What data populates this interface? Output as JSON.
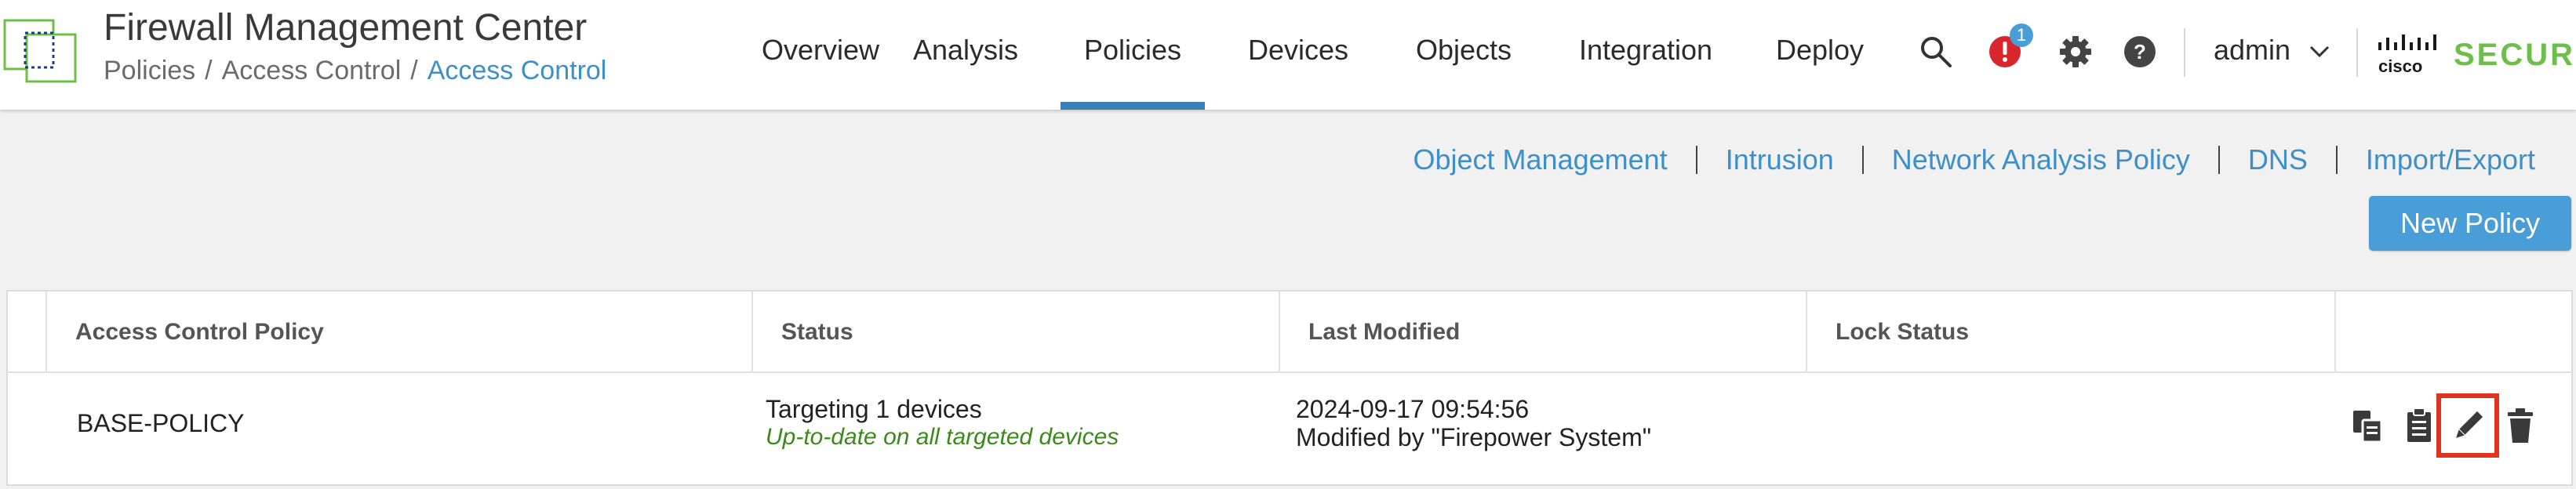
{
  "app": {
    "title": "Firewall Management Center",
    "breadcrumb": [
      "Policies",
      "Access Control",
      "Access Control"
    ],
    "breadcrumb_separator": "/"
  },
  "nav": {
    "items": [
      {
        "label": "Overview",
        "active": false
      },
      {
        "label": "Analysis",
        "active": false
      },
      {
        "label": "Policies",
        "active": true
      },
      {
        "label": "Devices",
        "active": false
      },
      {
        "label": "Objects",
        "active": false
      },
      {
        "label": "Integration",
        "active": false
      },
      {
        "label": "Deploy",
        "active": false
      }
    ],
    "alert_count": "1",
    "user": "admin",
    "brand_word": "SECURE",
    "brand_logo_text": "cisco"
  },
  "subnav": {
    "links": [
      "Object Management",
      "Intrusion",
      "Network Analysis Policy",
      "DNS",
      "Import/Export"
    ]
  },
  "actions": {
    "new_policy": "New Policy"
  },
  "table": {
    "columns": [
      "Access Control Policy",
      "Status",
      "Last Modified",
      "Lock Status"
    ],
    "rows": [
      {
        "name": "BASE-POLICY",
        "status": "Targeting 1 devices",
        "status_detail": "Up-to-date on all targeted devices",
        "modified_date": "2024-09-17 09:54:56",
        "modified_by": "Modified by \"Firepower System\"",
        "lock_status": ""
      }
    ]
  },
  "colors": {
    "accent_blue": "#4a9ed8",
    "link_blue": "#3c8fc8",
    "active_tab": "#3a7fb8",
    "status_green": "#3a8a1a",
    "alert_red": "#d9262c",
    "highlight_red": "#e2331f",
    "brand_green": "#6cc04a"
  }
}
